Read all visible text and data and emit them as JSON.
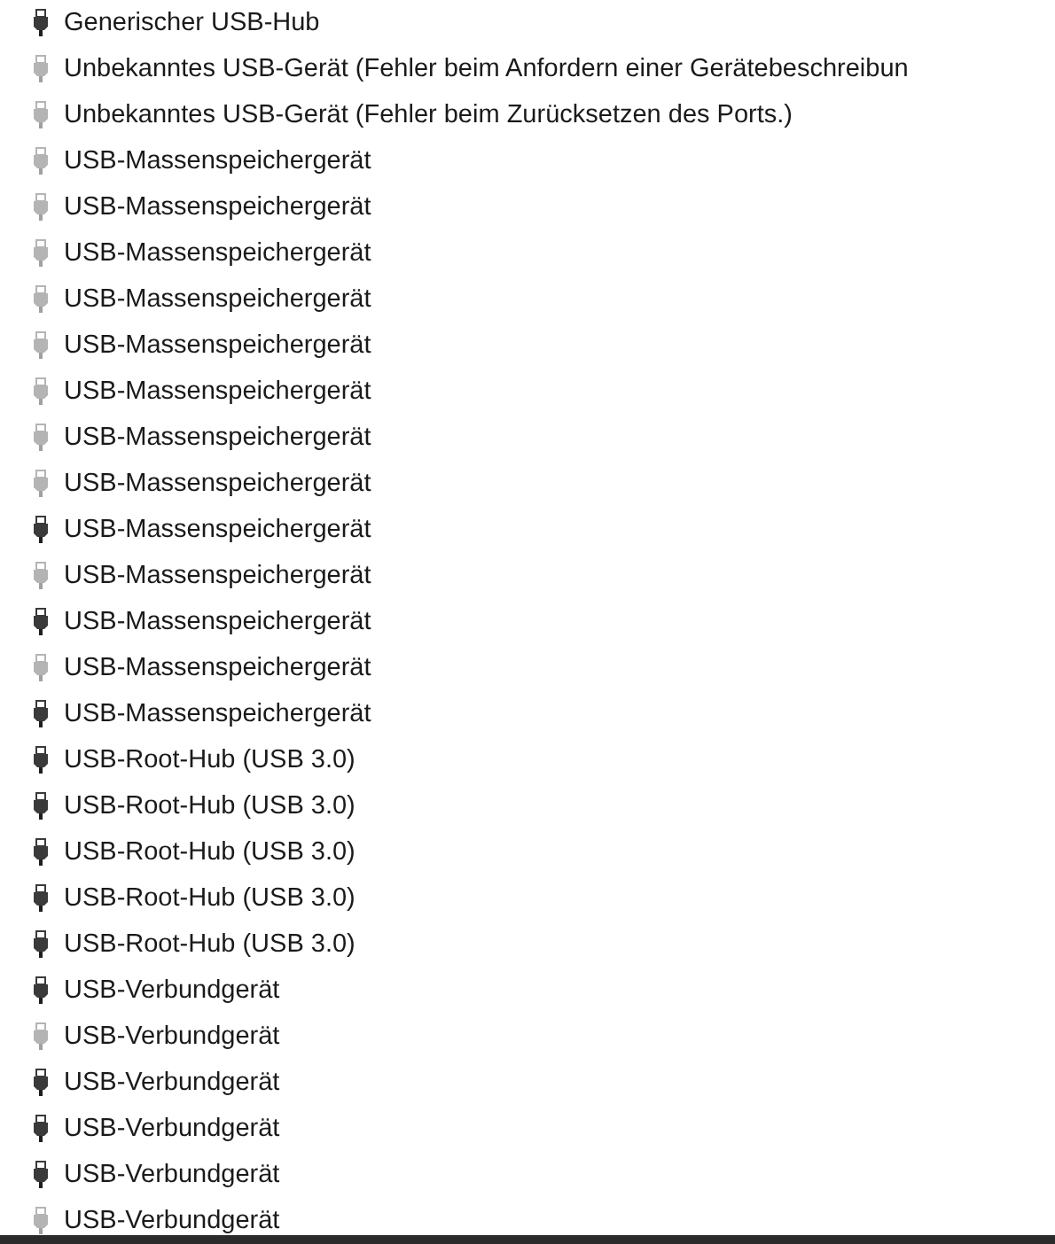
{
  "devices": [
    {
      "label": "Generischer USB-Hub",
      "connected": true
    },
    {
      "label": "Unbekanntes USB-Gerät (Fehler beim Anfordern einer Gerätebeschreibun",
      "connected": false
    },
    {
      "label": "Unbekanntes USB-Gerät (Fehler beim Zurücksetzen des Ports.)",
      "connected": false
    },
    {
      "label": "USB-Massenspeichergerät",
      "connected": false
    },
    {
      "label": "USB-Massenspeichergerät",
      "connected": false
    },
    {
      "label": "USB-Massenspeichergerät",
      "connected": false
    },
    {
      "label": "USB-Massenspeichergerät",
      "connected": false
    },
    {
      "label": "USB-Massenspeichergerät",
      "connected": false
    },
    {
      "label": "USB-Massenspeichergerät",
      "connected": false
    },
    {
      "label": "USB-Massenspeichergerät",
      "connected": false
    },
    {
      "label": "USB-Massenspeichergerät",
      "connected": false
    },
    {
      "label": "USB-Massenspeichergerät",
      "connected": true
    },
    {
      "label": "USB-Massenspeichergerät",
      "connected": false
    },
    {
      "label": "USB-Massenspeichergerät",
      "connected": true
    },
    {
      "label": "USB-Massenspeichergerät",
      "connected": false
    },
    {
      "label": "USB-Massenspeichergerät",
      "connected": true
    },
    {
      "label": "USB-Root-Hub (USB 3.0)",
      "connected": true
    },
    {
      "label": "USB-Root-Hub (USB 3.0)",
      "connected": true
    },
    {
      "label": "USB-Root-Hub (USB 3.0)",
      "connected": true
    },
    {
      "label": "USB-Root-Hub (USB 3.0)",
      "connected": true
    },
    {
      "label": "USB-Root-Hub (USB 3.0)",
      "connected": true
    },
    {
      "label": "USB-Verbundgerät",
      "connected": true
    },
    {
      "label": "USB-Verbundgerät",
      "connected": false
    },
    {
      "label": "USB-Verbundgerät",
      "connected": true
    },
    {
      "label": "USB-Verbundgerät",
      "connected": true
    },
    {
      "label": "USB-Verbundgerät",
      "connected": true
    },
    {
      "label": "USB-Verbundgerät",
      "connected": false
    }
  ]
}
